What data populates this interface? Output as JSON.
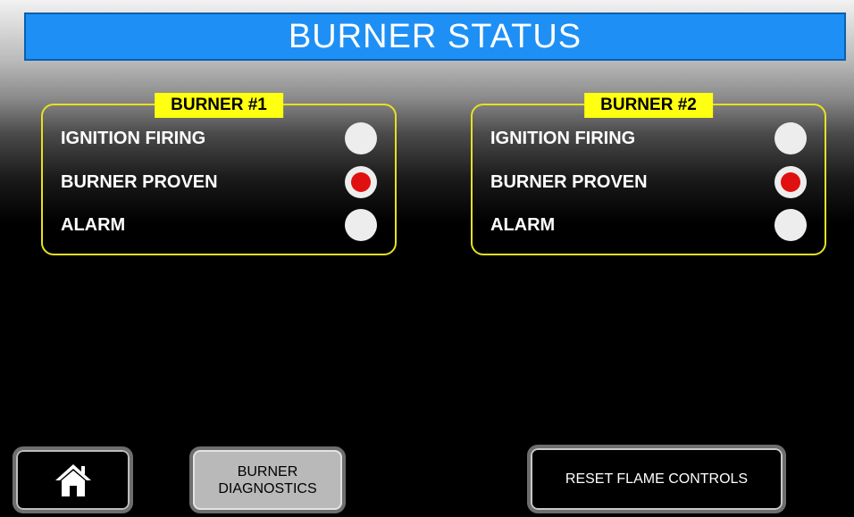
{
  "header": {
    "title": "BURNER STATUS"
  },
  "burners": [
    {
      "label": "BURNER #1",
      "rows": [
        {
          "label": "IGNITION FIRING",
          "state": "off"
        },
        {
          "label": "BURNER PROVEN",
          "state": "on"
        },
        {
          "label": "ALARM",
          "state": "off"
        }
      ]
    },
    {
      "label": "BURNER #2",
      "rows": [
        {
          "label": "IGNITION FIRING",
          "state": "off"
        },
        {
          "label": "BURNER PROVEN",
          "state": "on"
        },
        {
          "label": "ALARM",
          "state": "off"
        }
      ]
    }
  ],
  "footer": {
    "home_icon": "home-icon",
    "diagnostics_line1": "BURNER",
    "diagnostics_line2": "DIAGNOSTICS",
    "reset_label": "RESET FLAME CONTROLS"
  },
  "colors": {
    "title_bg": "#1e90f5",
    "panel_border": "#e8e020",
    "panel_label_bg": "#ffff10",
    "indicator_off": "#ededed",
    "indicator_on": "#e01010"
  }
}
